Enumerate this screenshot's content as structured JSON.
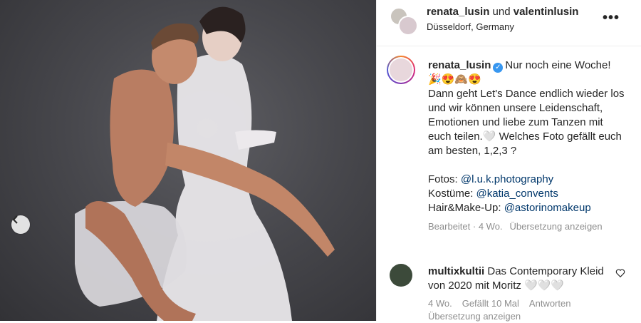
{
  "header": {
    "user1": "renata_lusin",
    "connector": "und",
    "user2": "valentinlusin",
    "location": "Düsseldorf, Germany"
  },
  "caption": {
    "username": "renata_lusin",
    "line1": "Nur noch eine Woche!",
    "emojis": "🎉😍🙈😍",
    "body": "Dann geht Let's Dance endlich wieder los und wir können unsere Leidenschaft, Emotionen und liebe zum Tanzen mit euch teilen.🤍 Welches Foto gefällt euch am besten, 1,2,3 ?",
    "fotos_label": "Fotos:",
    "fotos_link": "@l.u.k.photography",
    "kostueme_label": "Kostüme:",
    "kostueme_link": "@katia_convents",
    "hair_label": "Hair&Make-Up:",
    "hair_link": "@astorinomakeup",
    "edited": "Bearbeitet · 4 Wo.",
    "translate": "Übersetzung anzeigen"
  },
  "comment": {
    "username": "multixkultii",
    "text": "Das Contemporary Kleid von 2020 mit Moritz 🤍🤍🤍",
    "age": "4 Wo.",
    "likes": "Gefällt 10 Mal",
    "reply": "Antworten",
    "translate": "Übersetzung anzeigen"
  },
  "icons": [
    "chevron-left-icon",
    "more-icon",
    "verified-icon",
    "heart-icon"
  ],
  "colors": {
    "link": "#00376b",
    "meta": "#8e8e8e",
    "verified": "#3897f0"
  }
}
